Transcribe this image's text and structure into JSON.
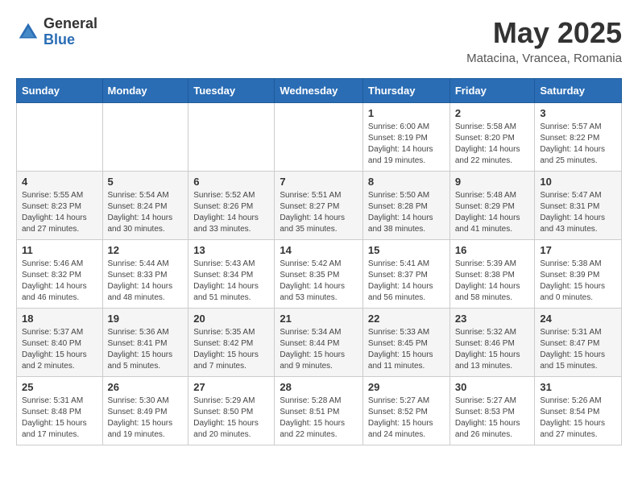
{
  "logo": {
    "general": "General",
    "blue": "Blue"
  },
  "header": {
    "month": "May 2025",
    "location": "Matacina, Vrancea, Romania"
  },
  "weekdays": [
    "Sunday",
    "Monday",
    "Tuesday",
    "Wednesday",
    "Thursday",
    "Friday",
    "Saturday"
  ],
  "weeks": [
    [
      {
        "day": "",
        "info": ""
      },
      {
        "day": "",
        "info": ""
      },
      {
        "day": "",
        "info": ""
      },
      {
        "day": "",
        "info": ""
      },
      {
        "day": "1",
        "info": "Sunrise: 6:00 AM\nSunset: 8:19 PM\nDaylight: 14 hours\nand 19 minutes."
      },
      {
        "day": "2",
        "info": "Sunrise: 5:58 AM\nSunset: 8:20 PM\nDaylight: 14 hours\nand 22 minutes."
      },
      {
        "day": "3",
        "info": "Sunrise: 5:57 AM\nSunset: 8:22 PM\nDaylight: 14 hours\nand 25 minutes."
      }
    ],
    [
      {
        "day": "4",
        "info": "Sunrise: 5:55 AM\nSunset: 8:23 PM\nDaylight: 14 hours\nand 27 minutes."
      },
      {
        "day": "5",
        "info": "Sunrise: 5:54 AM\nSunset: 8:24 PM\nDaylight: 14 hours\nand 30 minutes."
      },
      {
        "day": "6",
        "info": "Sunrise: 5:52 AM\nSunset: 8:26 PM\nDaylight: 14 hours\nand 33 minutes."
      },
      {
        "day": "7",
        "info": "Sunrise: 5:51 AM\nSunset: 8:27 PM\nDaylight: 14 hours\nand 35 minutes."
      },
      {
        "day": "8",
        "info": "Sunrise: 5:50 AM\nSunset: 8:28 PM\nDaylight: 14 hours\nand 38 minutes."
      },
      {
        "day": "9",
        "info": "Sunrise: 5:48 AM\nSunset: 8:29 PM\nDaylight: 14 hours\nand 41 minutes."
      },
      {
        "day": "10",
        "info": "Sunrise: 5:47 AM\nSunset: 8:31 PM\nDaylight: 14 hours\nand 43 minutes."
      }
    ],
    [
      {
        "day": "11",
        "info": "Sunrise: 5:46 AM\nSunset: 8:32 PM\nDaylight: 14 hours\nand 46 minutes."
      },
      {
        "day": "12",
        "info": "Sunrise: 5:44 AM\nSunset: 8:33 PM\nDaylight: 14 hours\nand 48 minutes."
      },
      {
        "day": "13",
        "info": "Sunrise: 5:43 AM\nSunset: 8:34 PM\nDaylight: 14 hours\nand 51 minutes."
      },
      {
        "day": "14",
        "info": "Sunrise: 5:42 AM\nSunset: 8:35 PM\nDaylight: 14 hours\nand 53 minutes."
      },
      {
        "day": "15",
        "info": "Sunrise: 5:41 AM\nSunset: 8:37 PM\nDaylight: 14 hours\nand 56 minutes."
      },
      {
        "day": "16",
        "info": "Sunrise: 5:39 AM\nSunset: 8:38 PM\nDaylight: 14 hours\nand 58 minutes."
      },
      {
        "day": "17",
        "info": "Sunrise: 5:38 AM\nSunset: 8:39 PM\nDaylight: 15 hours\nand 0 minutes."
      }
    ],
    [
      {
        "day": "18",
        "info": "Sunrise: 5:37 AM\nSunset: 8:40 PM\nDaylight: 15 hours\nand 2 minutes."
      },
      {
        "day": "19",
        "info": "Sunrise: 5:36 AM\nSunset: 8:41 PM\nDaylight: 15 hours\nand 5 minutes."
      },
      {
        "day": "20",
        "info": "Sunrise: 5:35 AM\nSunset: 8:42 PM\nDaylight: 15 hours\nand 7 minutes."
      },
      {
        "day": "21",
        "info": "Sunrise: 5:34 AM\nSunset: 8:44 PM\nDaylight: 15 hours\nand 9 minutes."
      },
      {
        "day": "22",
        "info": "Sunrise: 5:33 AM\nSunset: 8:45 PM\nDaylight: 15 hours\nand 11 minutes."
      },
      {
        "day": "23",
        "info": "Sunrise: 5:32 AM\nSunset: 8:46 PM\nDaylight: 15 hours\nand 13 minutes."
      },
      {
        "day": "24",
        "info": "Sunrise: 5:31 AM\nSunset: 8:47 PM\nDaylight: 15 hours\nand 15 minutes."
      }
    ],
    [
      {
        "day": "25",
        "info": "Sunrise: 5:31 AM\nSunset: 8:48 PM\nDaylight: 15 hours\nand 17 minutes."
      },
      {
        "day": "26",
        "info": "Sunrise: 5:30 AM\nSunset: 8:49 PM\nDaylight: 15 hours\nand 19 minutes."
      },
      {
        "day": "27",
        "info": "Sunrise: 5:29 AM\nSunset: 8:50 PM\nDaylight: 15 hours\nand 20 minutes."
      },
      {
        "day": "28",
        "info": "Sunrise: 5:28 AM\nSunset: 8:51 PM\nDaylight: 15 hours\nand 22 minutes."
      },
      {
        "day": "29",
        "info": "Sunrise: 5:27 AM\nSunset: 8:52 PM\nDaylight: 15 hours\nand 24 minutes."
      },
      {
        "day": "30",
        "info": "Sunrise: 5:27 AM\nSunset: 8:53 PM\nDaylight: 15 hours\nand 26 minutes."
      },
      {
        "day": "31",
        "info": "Sunrise: 5:26 AM\nSunset: 8:54 PM\nDaylight: 15 hours\nand 27 minutes."
      }
    ]
  ]
}
